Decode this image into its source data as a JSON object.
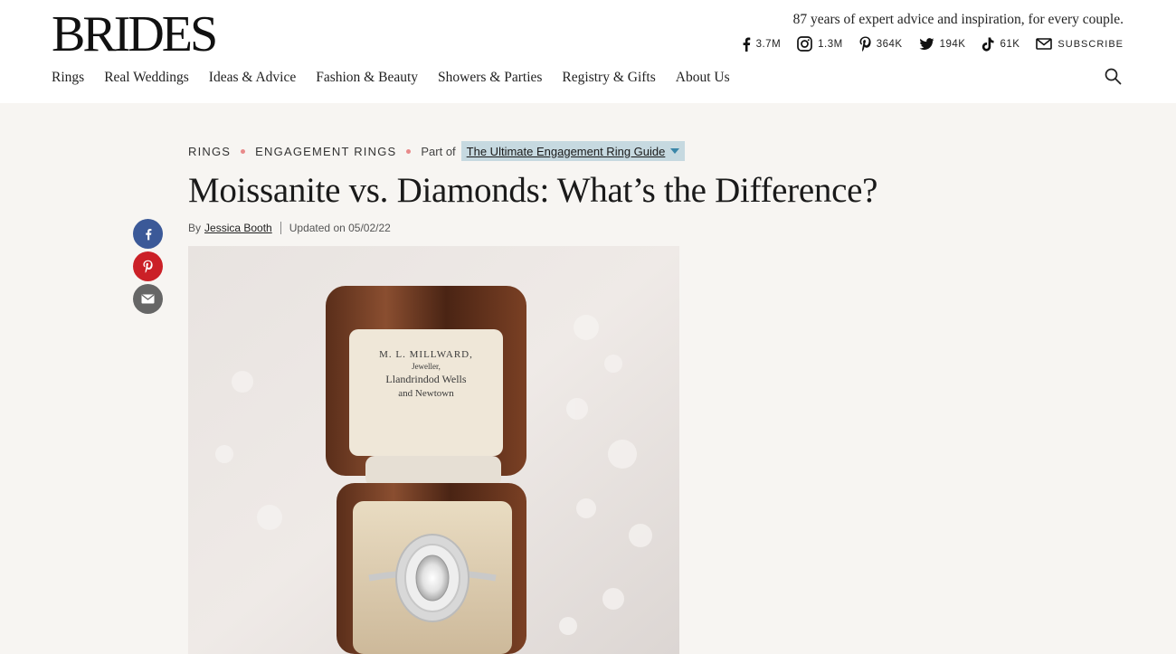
{
  "header": {
    "logo": "BRIDES",
    "tagline": "87 years of expert advice and inspiration, for every couple.",
    "socials": [
      {
        "icon": "facebook-icon",
        "count": "3.7M"
      },
      {
        "icon": "instagram-icon",
        "count": "1.3M"
      },
      {
        "icon": "pinterest-icon",
        "count": "364K"
      },
      {
        "icon": "twitter-icon",
        "count": "194K"
      },
      {
        "icon": "tiktok-icon",
        "count": "61K"
      }
    ],
    "subscribe_label": "SUBSCRIBE",
    "nav": [
      "Rings",
      "Real Weddings",
      "Ideas & Advice",
      "Fashion & Beauty",
      "Showers & Parties",
      "Registry & Gifts",
      "About Us"
    ]
  },
  "breadcrumb": {
    "cat1": "RINGS",
    "cat2": "ENGAGEMENT RINGS",
    "part_of": "Part of",
    "guide": "The Ultimate Engagement Ring Guide"
  },
  "article": {
    "title": "Moissanite vs. Diamonds: What’s the Difference?",
    "by": "By",
    "author": "Jessica Booth",
    "updated": "Updated on 05/02/22",
    "box_engraving": [
      "M. L. MILLWARD,",
      "Jeweller,",
      "Llandrindod Wells",
      "and Newtown"
    ]
  },
  "colors": {
    "facebook": "#3b5998",
    "pinterest": "#cb2027",
    "email": "#666666",
    "breadcrumb_dot": "#e88a8a",
    "guide_bg": "#c6d9e0"
  }
}
